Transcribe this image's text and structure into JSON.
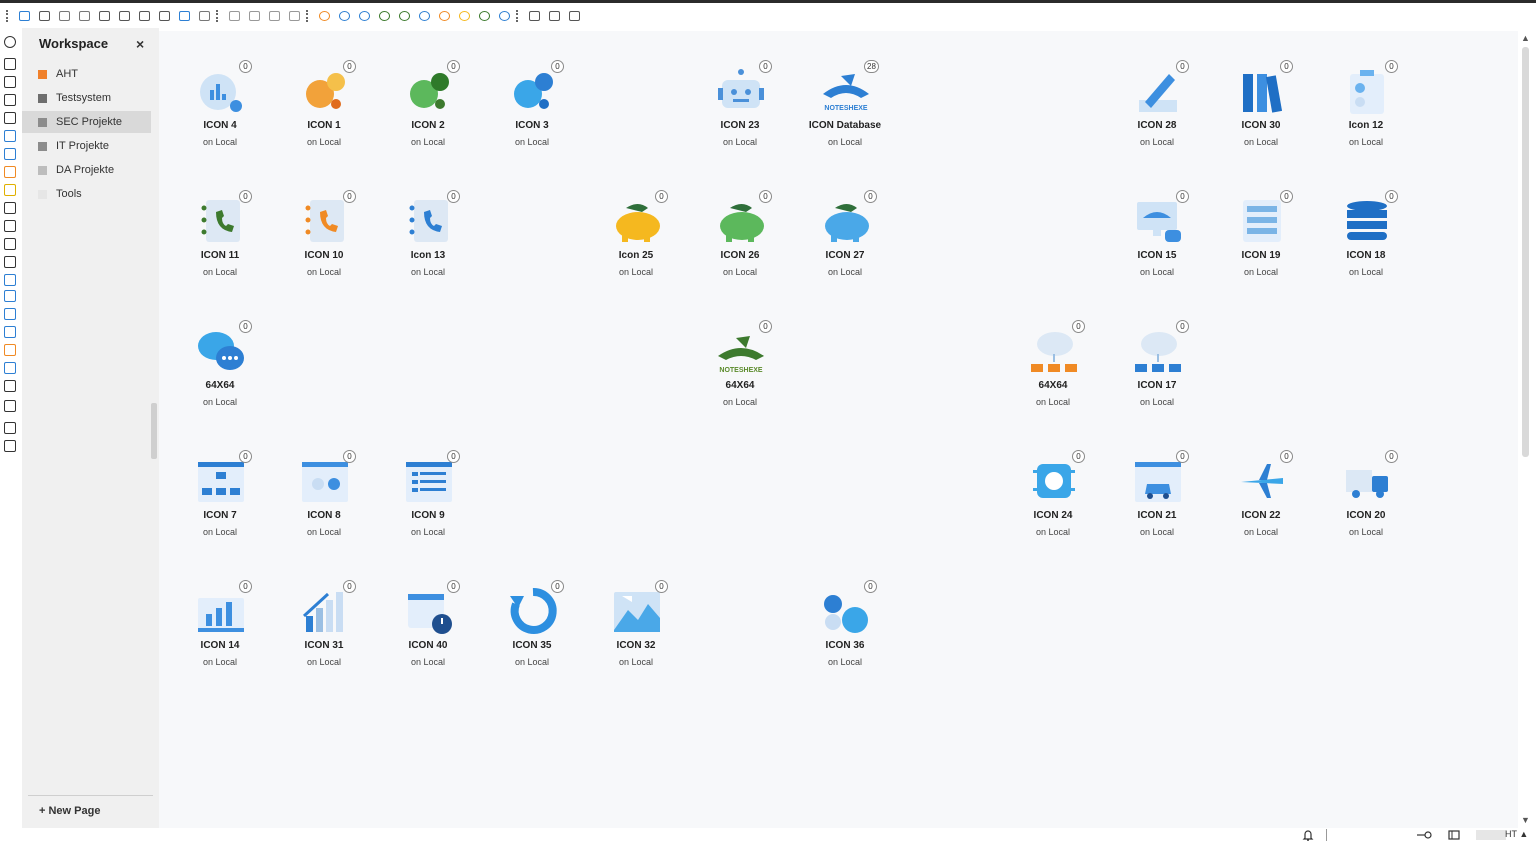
{
  "workspace": {
    "title": "Workspace",
    "close_label": "×",
    "items": [
      {
        "label": "AHT",
        "color": "#f0802a",
        "selected": false
      },
      {
        "label": "Testsystem",
        "color": "#6e6e6e",
        "selected": false
      },
      {
        "label": "SEC Projekte",
        "color": "#8c8c8c",
        "selected": true
      },
      {
        "label": "IT Projekte",
        "color": "#8c8c8c",
        "selected": false
      },
      {
        "label": "DA Projekte",
        "color": "#bdbdbd",
        "selected": false
      },
      {
        "label": "Tools",
        "color": "#e6e6e6",
        "selected": false
      }
    ],
    "new_page_label": "+ New Page"
  },
  "status": {
    "user_label": "HT ▲"
  },
  "tiles": [
    {
      "name": "ICON 4",
      "sub": "on Local",
      "badge": "0",
      "icon": "chart-gear-icon",
      "color": "#3d8fe0",
      "col": 0,
      "row": 0
    },
    {
      "name": "ICON 1",
      "sub": "on Local",
      "badge": "0",
      "icon": "orange-gear-icon",
      "color": "#f2a23a",
      "col": 1,
      "row": 0
    },
    {
      "name": "ICON 2",
      "sub": "on Local",
      "badge": "0",
      "icon": "green-gear-icon",
      "color": "#5cb85c",
      "col": 2,
      "row": 0
    },
    {
      "name": "ICON 3",
      "sub": "on Local",
      "badge": "0",
      "icon": "blue-gear-icon",
      "color": "#3aa6e8",
      "col": 3,
      "row": 0
    },
    {
      "name": "ICON 23",
      "sub": "on Local",
      "badge": "0",
      "icon": "robot-icon",
      "color": "#4a90d9",
      "col": 5,
      "row": 0
    },
    {
      "name": "ICON Database",
      "sub": "on Local",
      "badge": "28",
      "icon": "notes-hat-blue-icon",
      "color": "#2d7fd3",
      "col": 6,
      "row": 0
    },
    {
      "name": "ICON 28",
      "sub": "on Local",
      "badge": "0",
      "icon": "pen-icon",
      "color": "#3d8fe0",
      "col": 9,
      "row": 0
    },
    {
      "name": "ICON 30",
      "sub": "on Local",
      "badge": "0",
      "icon": "binders-icon",
      "color": "#1f6fc5",
      "col": 10,
      "row": 0
    },
    {
      "name": "Icon 12",
      "sub": "on Local",
      "badge": "0",
      "icon": "clipboard-icon",
      "color": "#6ab2ef",
      "col": 11,
      "row": 0
    },
    {
      "name": "ICON 11",
      "sub": "on Local",
      "badge": "0",
      "icon": "phonebook-green-icon",
      "color": "#3d7a2e",
      "col": 0,
      "row": 1
    },
    {
      "name": "ICON 10",
      "sub": "on Local",
      "badge": "0",
      "icon": "phonebook-orange-icon",
      "color": "#f08a24",
      "col": 1,
      "row": 1
    },
    {
      "name": "Icon 13",
      "sub": "on Local",
      "badge": "0",
      "icon": "phonebook-blue-icon",
      "color": "#2d7fd3",
      "col": 2,
      "row": 1
    },
    {
      "name": "Icon 25",
      "sub": "on Local",
      "badge": "0",
      "icon": "piggy-yellow-icon",
      "color": "#f5b81f",
      "col": 4,
      "row": 1
    },
    {
      "name": "ICON 26",
      "sub": "on Local",
      "badge": "0",
      "icon": "piggy-green-icon",
      "color": "#5cb85c",
      "col": 5,
      "row": 1
    },
    {
      "name": "ICON 27",
      "sub": "on Local",
      "badge": "0",
      "icon": "piggy-blue-icon",
      "color": "#4aa8e8",
      "col": 6,
      "row": 1
    },
    {
      "name": "ICON 15",
      "sub": "on Local",
      "badge": "0",
      "icon": "monitor-robot-icon",
      "color": "#3d8fe0",
      "col": 9,
      "row": 1
    },
    {
      "name": "ICON 19",
      "sub": "on Local",
      "badge": "0",
      "icon": "server-rack-icon",
      "color": "#7ab4e6",
      "col": 10,
      "row": 1
    },
    {
      "name": "ICON 18",
      "sub": "on Local",
      "badge": "0",
      "icon": "database-stack-icon",
      "color": "#1f6fc5",
      "col": 11,
      "row": 1
    },
    {
      "name": "64X64",
      "sub": "on Local",
      "badge": "0",
      "icon": "chat-bubbles-icon",
      "color": "#3aa6e8",
      "col": 0,
      "row": 2
    },
    {
      "name": "64X64",
      "sub": "on Local",
      "badge": "0",
      "icon": "notes-hat-green-icon",
      "color": "#3d7a2e",
      "col": 5,
      "row": 2
    },
    {
      "name": "64X64",
      "sub": "on Local",
      "badge": "0",
      "icon": "cloud-orange-network-icon",
      "color": "#f08a24",
      "col": 8,
      "row": 2
    },
    {
      "name": "ICON 17",
      "sub": "on Local",
      "badge": "0",
      "icon": "cloud-blue-network-icon",
      "color": "#2d7fd3",
      "col": 9,
      "row": 2
    },
    {
      "name": "ICON 7",
      "sub": "on Local",
      "badge": "0",
      "icon": "sitemap-window-icon",
      "color": "#2d7fd3",
      "col": 0,
      "row": 3
    },
    {
      "name": "ICON 8",
      "sub": "on Local",
      "badge": "0",
      "icon": "toggle-window-icon",
      "color": "#6ab2ef",
      "col": 1,
      "row": 3
    },
    {
      "name": "ICON 9",
      "sub": "on Local",
      "badge": "0",
      "icon": "list-window-icon",
      "color": "#2d7fd3",
      "col": 2,
      "row": 3
    },
    {
      "name": "ICON 24",
      "sub": "on Local",
      "badge": "0",
      "icon": "chip-icon",
      "color": "#3aa6e8",
      "col": 8,
      "row": 3
    },
    {
      "name": "ICON 21",
      "sub": "on Local",
      "badge": "0",
      "icon": "car-window-icon",
      "color": "#3d8fe0",
      "col": 9,
      "row": 3
    },
    {
      "name": "ICON 22",
      "sub": "on Local",
      "badge": "0",
      "icon": "airplane-icon",
      "color": "#3aa6e8",
      "col": 10,
      "row": 3
    },
    {
      "name": "ICON 20",
      "sub": "on Local",
      "badge": "0",
      "icon": "truck-icon",
      "color": "#2d7fd3",
      "col": 11,
      "row": 3
    },
    {
      "name": "ICON 14",
      "sub": "on Local",
      "badge": "0",
      "icon": "bar-chart-icon",
      "color": "#3d8fe0",
      "col": 0,
      "row": 4
    },
    {
      "name": "ICON 31",
      "sub": "on Local",
      "badge": "0",
      "icon": "growth-chart-icon",
      "color": "#2d7fd3",
      "col": 1,
      "row": 4
    },
    {
      "name": "ICON 40",
      "sub": "on Local",
      "badge": "0",
      "icon": "calendar-clock-icon",
      "color": "#3d8fe0",
      "col": 2,
      "row": 4
    },
    {
      "name": "ICON 35",
      "sub": "on Local",
      "badge": "0",
      "icon": "refresh-icon",
      "color": "#2d8fe0",
      "col": 3,
      "row": 4
    },
    {
      "name": "ICON 32",
      "sub": "on Local",
      "badge": "0",
      "icon": "mountain-picture-icon",
      "color": "#4aa8e8",
      "col": 4,
      "row": 4
    },
    {
      "name": "ICON 36",
      "sub": "on Local",
      "badge": "0",
      "icon": "pills-icon",
      "color": "#2d7fd3",
      "col": 6,
      "row": 4
    }
  ]
}
